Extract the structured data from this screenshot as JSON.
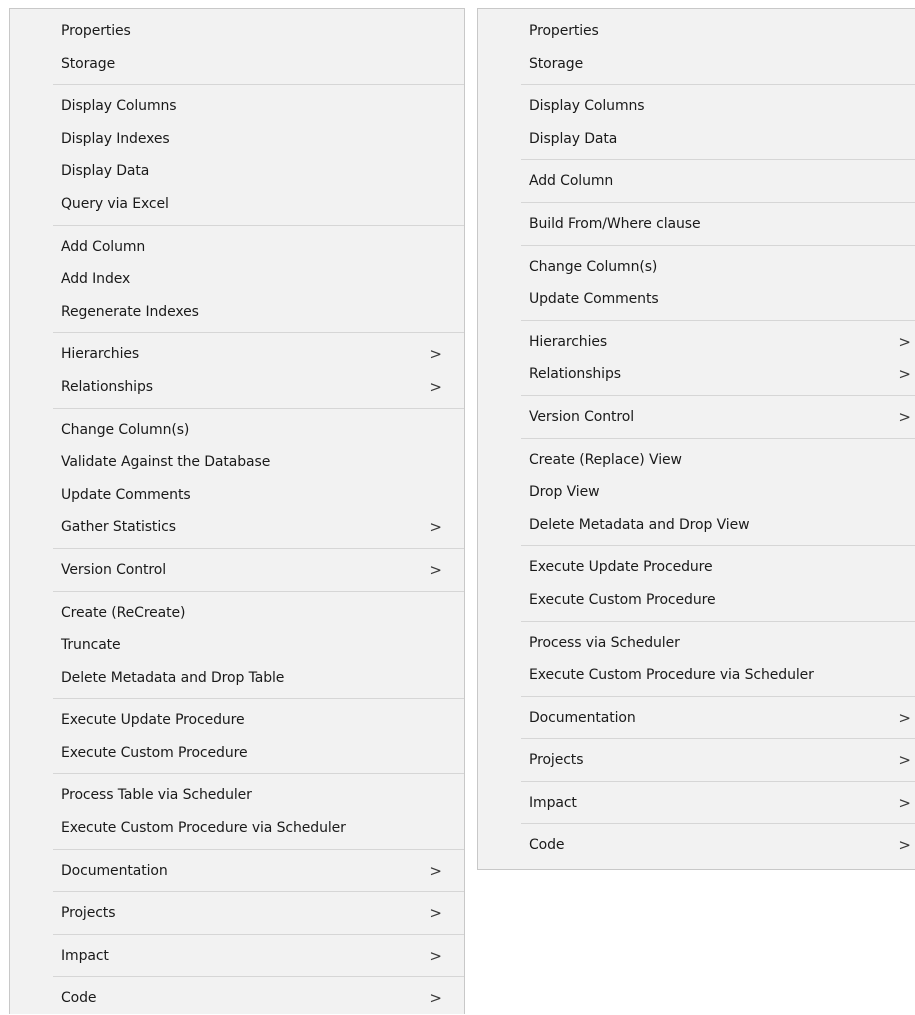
{
  "menus": [
    {
      "id": "left",
      "items": [
        {
          "label": "Properties"
        },
        {
          "label": "Storage"
        },
        {
          "sep": true
        },
        {
          "label": "Display Columns"
        },
        {
          "label": "Display Indexes"
        },
        {
          "label": "Display Data"
        },
        {
          "label": "Query via Excel"
        },
        {
          "sep": true
        },
        {
          "label": "Add Column"
        },
        {
          "label": "Add Index"
        },
        {
          "label": "Regenerate Indexes"
        },
        {
          "sep": true
        },
        {
          "label": "Hierarchies",
          "submenu": true
        },
        {
          "label": "Relationships",
          "submenu": true
        },
        {
          "sep": true
        },
        {
          "label": "Change Column(s)"
        },
        {
          "label": "Validate Against the Database"
        },
        {
          "label": "Update Comments"
        },
        {
          "label": "Gather Statistics",
          "submenu": true
        },
        {
          "sep": true
        },
        {
          "label": "Version Control",
          "submenu": true
        },
        {
          "sep": true
        },
        {
          "label": "Create (ReCreate)"
        },
        {
          "label": "Truncate"
        },
        {
          "label": "Delete Metadata and Drop Table"
        },
        {
          "sep": true
        },
        {
          "label": "Execute Update Procedure"
        },
        {
          "label": "Execute Custom Procedure"
        },
        {
          "sep": true
        },
        {
          "label": "Process Table via Scheduler"
        },
        {
          "label": "Execute Custom Procedure via Scheduler"
        },
        {
          "sep": true
        },
        {
          "label": "Documentation",
          "submenu": true
        },
        {
          "sep": true
        },
        {
          "label": "Projects",
          "submenu": true
        },
        {
          "sep": true
        },
        {
          "label": "Impact",
          "submenu": true
        },
        {
          "sep": true
        },
        {
          "label": "Code",
          "submenu": true
        }
      ]
    },
    {
      "id": "right",
      "items": [
        {
          "label": "Properties"
        },
        {
          "label": "Storage"
        },
        {
          "sep": true
        },
        {
          "label": "Display Columns"
        },
        {
          "label": "Display Data"
        },
        {
          "sep": true
        },
        {
          "label": "Add Column"
        },
        {
          "sep": true
        },
        {
          "label": "Build From/Where clause"
        },
        {
          "sep": true
        },
        {
          "label": "Change Column(s)"
        },
        {
          "label": "Update Comments"
        },
        {
          "sep": true
        },
        {
          "label": "Hierarchies",
          "submenu": true
        },
        {
          "label": "Relationships",
          "submenu": true
        },
        {
          "sep": true
        },
        {
          "label": "Version Control",
          "submenu": true
        },
        {
          "sep": true
        },
        {
          "label": "Create (Replace) View"
        },
        {
          "label": "Drop View"
        },
        {
          "label": "Delete Metadata and Drop View"
        },
        {
          "sep": true
        },
        {
          "label": "Execute Update Procedure"
        },
        {
          "label": "Execute Custom Procedure"
        },
        {
          "sep": true
        },
        {
          "label": "Process via Scheduler"
        },
        {
          "label": "Execute Custom Procedure via Scheduler"
        },
        {
          "sep": true
        },
        {
          "label": "Documentation",
          "submenu": true
        },
        {
          "sep": true
        },
        {
          "label": "Projects",
          "submenu": true
        },
        {
          "sep": true
        },
        {
          "label": "Impact",
          "submenu": true
        },
        {
          "sep": true
        },
        {
          "label": "Code",
          "submenu": true
        }
      ]
    }
  ],
  "submenu_arrow": ">"
}
